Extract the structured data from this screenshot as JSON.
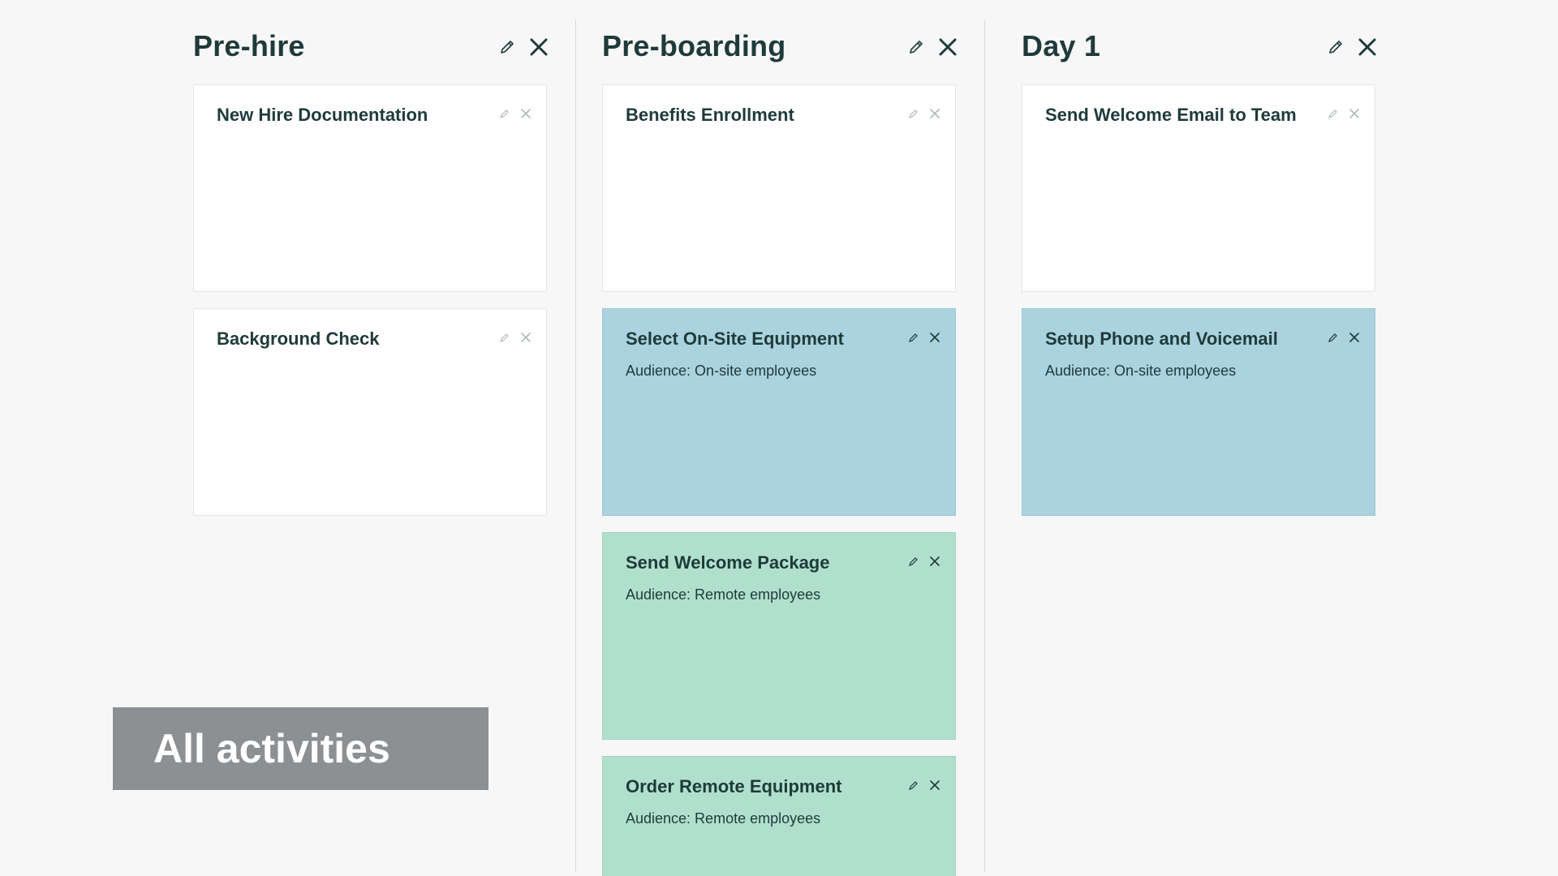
{
  "colors": {
    "background": "#f7f7f7",
    "text": "#1f3a3a",
    "card_white": "#ffffff",
    "card_blue": "#aad3df",
    "card_green": "#b0e0cd",
    "banner": "#8c9092"
  },
  "columns": [
    {
      "title": "Pre-hire",
      "icons": [
        "pencil-icon",
        "close-icon"
      ],
      "cards": [
        {
          "title": "New Hire Documentation",
          "subtitle": "",
          "color": "white"
        },
        {
          "title": "Background Check",
          "subtitle": "",
          "color": "white"
        }
      ]
    },
    {
      "title": "Pre-boarding",
      "icons": [
        "pencil-icon",
        "close-icon"
      ],
      "cards": [
        {
          "title": "Benefits Enrollment",
          "subtitle": "",
          "color": "white"
        },
        {
          "title": "Select On-Site Equipment",
          "subtitle": "Audience: On-site employees",
          "color": "blue"
        },
        {
          "title": "Send Welcome Package",
          "subtitle": "Audience: Remote employees",
          "color": "green"
        },
        {
          "title": "Order Remote Equipment",
          "subtitle": "Audience: Remote employees",
          "color": "green"
        }
      ]
    },
    {
      "title": "Day 1",
      "icons": [
        "pencil-icon",
        "close-icon"
      ],
      "cards": [
        {
          "title": "Send Welcome Email to Team",
          "subtitle": "",
          "color": "white"
        },
        {
          "title": "Setup Phone and Voicemail",
          "subtitle": "Audience: On-site employees",
          "color": "blue"
        }
      ]
    }
  ],
  "banner": {
    "label": "All activities"
  }
}
